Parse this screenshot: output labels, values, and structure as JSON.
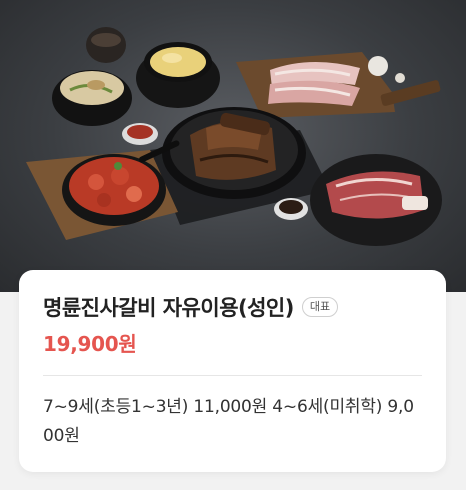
{
  "product": {
    "title": "명륜진사갈비 자유이용(성인)",
    "badge": "대표",
    "price": "19,900원",
    "description": "7~9세(초등1~3년) 11,000원 4~6세(미취학) 9,000원"
  },
  "image": {
    "alt": "food-photo-korean-bbq-spread"
  },
  "colors": {
    "price": "#e5554f",
    "background": "#f2f2f2",
    "card": "#ffffff"
  }
}
